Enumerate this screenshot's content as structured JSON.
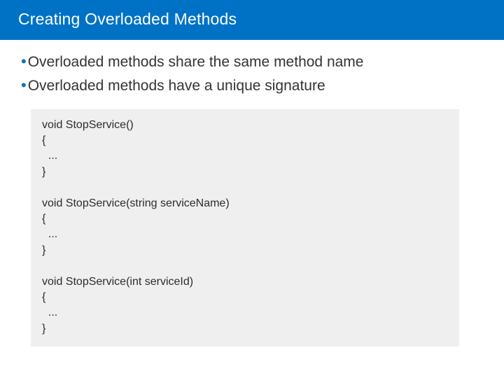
{
  "header": {
    "title": "Creating Overloaded Methods"
  },
  "bullets": [
    "Overloaded methods share the same method name",
    "Overloaded methods have a unique signature"
  ],
  "code": "void StopService()\n{\n  ...\n}\n\nvoid StopService(string serviceName)\n{\n  ...\n}\n\nvoid StopService(int serviceId)\n{\n  ...\n}"
}
